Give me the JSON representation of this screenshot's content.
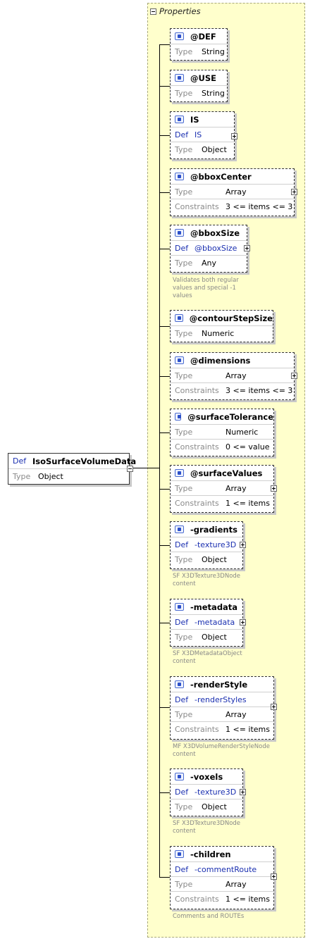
{
  "root": {
    "def_key": "Def",
    "name": "IsoSurfaceVolumeData",
    "type_key": "Type",
    "type": "Object"
  },
  "panel_title": "Properties",
  "nodes": [
    {
      "name": "@DEF",
      "type_key": "Type",
      "type": "String"
    },
    {
      "name": "@USE",
      "type_key": "Type",
      "type": "String"
    },
    {
      "name": "IS",
      "def_key": "Def",
      "def": "IS",
      "type_key": "Type",
      "type": "Object"
    },
    {
      "name": "@bboxCenter",
      "type_key": "Type",
      "type": "Array",
      "constraints_key": "Constraints",
      "constraints": "3 <= items <= 3"
    },
    {
      "name": "@bboxSize",
      "def_key": "Def",
      "def": "@bboxSize",
      "type_key": "Type",
      "type": "Any",
      "note": "Validates both regular values and special -1 values"
    },
    {
      "name": "@contourStepSize",
      "type_key": "Type",
      "type": "Numeric"
    },
    {
      "name": "@dimensions",
      "type_key": "Type",
      "type": "Array",
      "constraints_key": "Constraints",
      "constraints": "3 <= items <= 3"
    },
    {
      "name": "@surfaceTolerance",
      "type_key": "Type",
      "type": "Numeric",
      "constraints_key": "Constraints",
      "constraints": "0 <= value"
    },
    {
      "name": "@surfaceValues",
      "type_key": "Type",
      "type": "Array",
      "constraints_key": "Constraints",
      "constraints": "1 <= items"
    },
    {
      "name": "-gradients",
      "def_key": "Def",
      "def": "-texture3D",
      "type_key": "Type",
      "type": "Object",
      "note": "SF X3DTexture3DNode content"
    },
    {
      "name": "-metadata",
      "def_key": "Def",
      "def": "-metadata",
      "type_key": "Type",
      "type": "Object",
      "note": "SF X3DMetadataObject content"
    },
    {
      "name": "-renderStyle",
      "def_key": "Def",
      "def": "-renderStyles",
      "type_key": "Type",
      "type": "Array",
      "constraints_key": "Constraints",
      "constraints": "1 <= items",
      "note": "MF X3DVolumeRenderStyleNode content"
    },
    {
      "name": "-voxels",
      "def_key": "Def",
      "def": "-texture3D",
      "type_key": "Type",
      "type": "Object",
      "note": "SF X3DTexture3DNode content"
    },
    {
      "name": "-children",
      "def_key": "Def",
      "def": "-commentRoute",
      "type_key": "Type",
      "type": "Array",
      "constraints_key": "Constraints",
      "constraints": "1 <= items",
      "note": "Comments and ROUTEs"
    }
  ]
}
